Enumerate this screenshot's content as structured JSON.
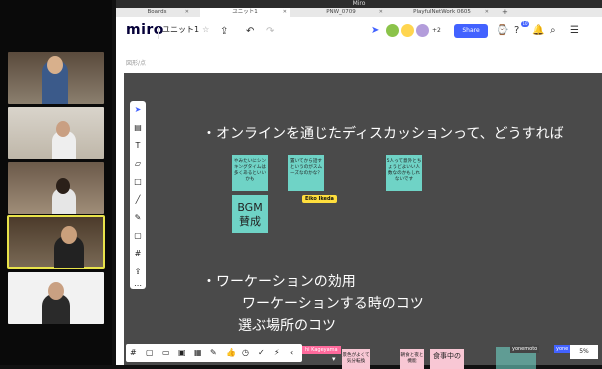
{
  "window": {
    "title": "Miro"
  },
  "tabs": [
    {
      "label": "Boards",
      "active": false
    },
    {
      "label": "ユニット1",
      "active": true
    },
    {
      "label": "PNW_0709",
      "active": false
    },
    {
      "label": "PlayfulNetWork 0605",
      "active": false
    }
  ],
  "app": {
    "logo": "miro",
    "board_name": "ユニット1",
    "star_icon": "☆",
    "participants_more": "+2",
    "share_label": "Share",
    "notification_count": "10",
    "subtool_label": "図形/点",
    "zoom_pct": "5%"
  },
  "canvas": {
    "heading1": "・オンラインを通じたディスカッションって、どうすれば",
    "heading2": "・ワーケーションの効用",
    "heading3": "ワーケーションする時のコツ",
    "heading4": "選ぶ場所のコツ",
    "stickies": [
      {
        "text": "やみたいにシンキングタイムは多くあるといいかも"
      },
      {
        "text": "置いてから話すというのがスムーズなのかな？"
      },
      {
        "text": "5人って意外とちょうどよいい人数なのかもしれないです"
      },
      {
        "text": "BGM\n賛成"
      }
    ],
    "badge_name": "Eiko Ikeda",
    "cursor_tag": "hi Kageyama",
    "bottom_stickies": [
      {
        "text": "景色がよくて気分転換"
      },
      {
        "text": "朝食と夜と機能"
      },
      {
        "text": "食事中の"
      }
    ],
    "user_tag": "yonemoto",
    "user_tag2": "yone"
  },
  "colors": {
    "accent": "#4262ff",
    "sticky": "#6fd3c6",
    "canvas": "#4a4a4a"
  }
}
